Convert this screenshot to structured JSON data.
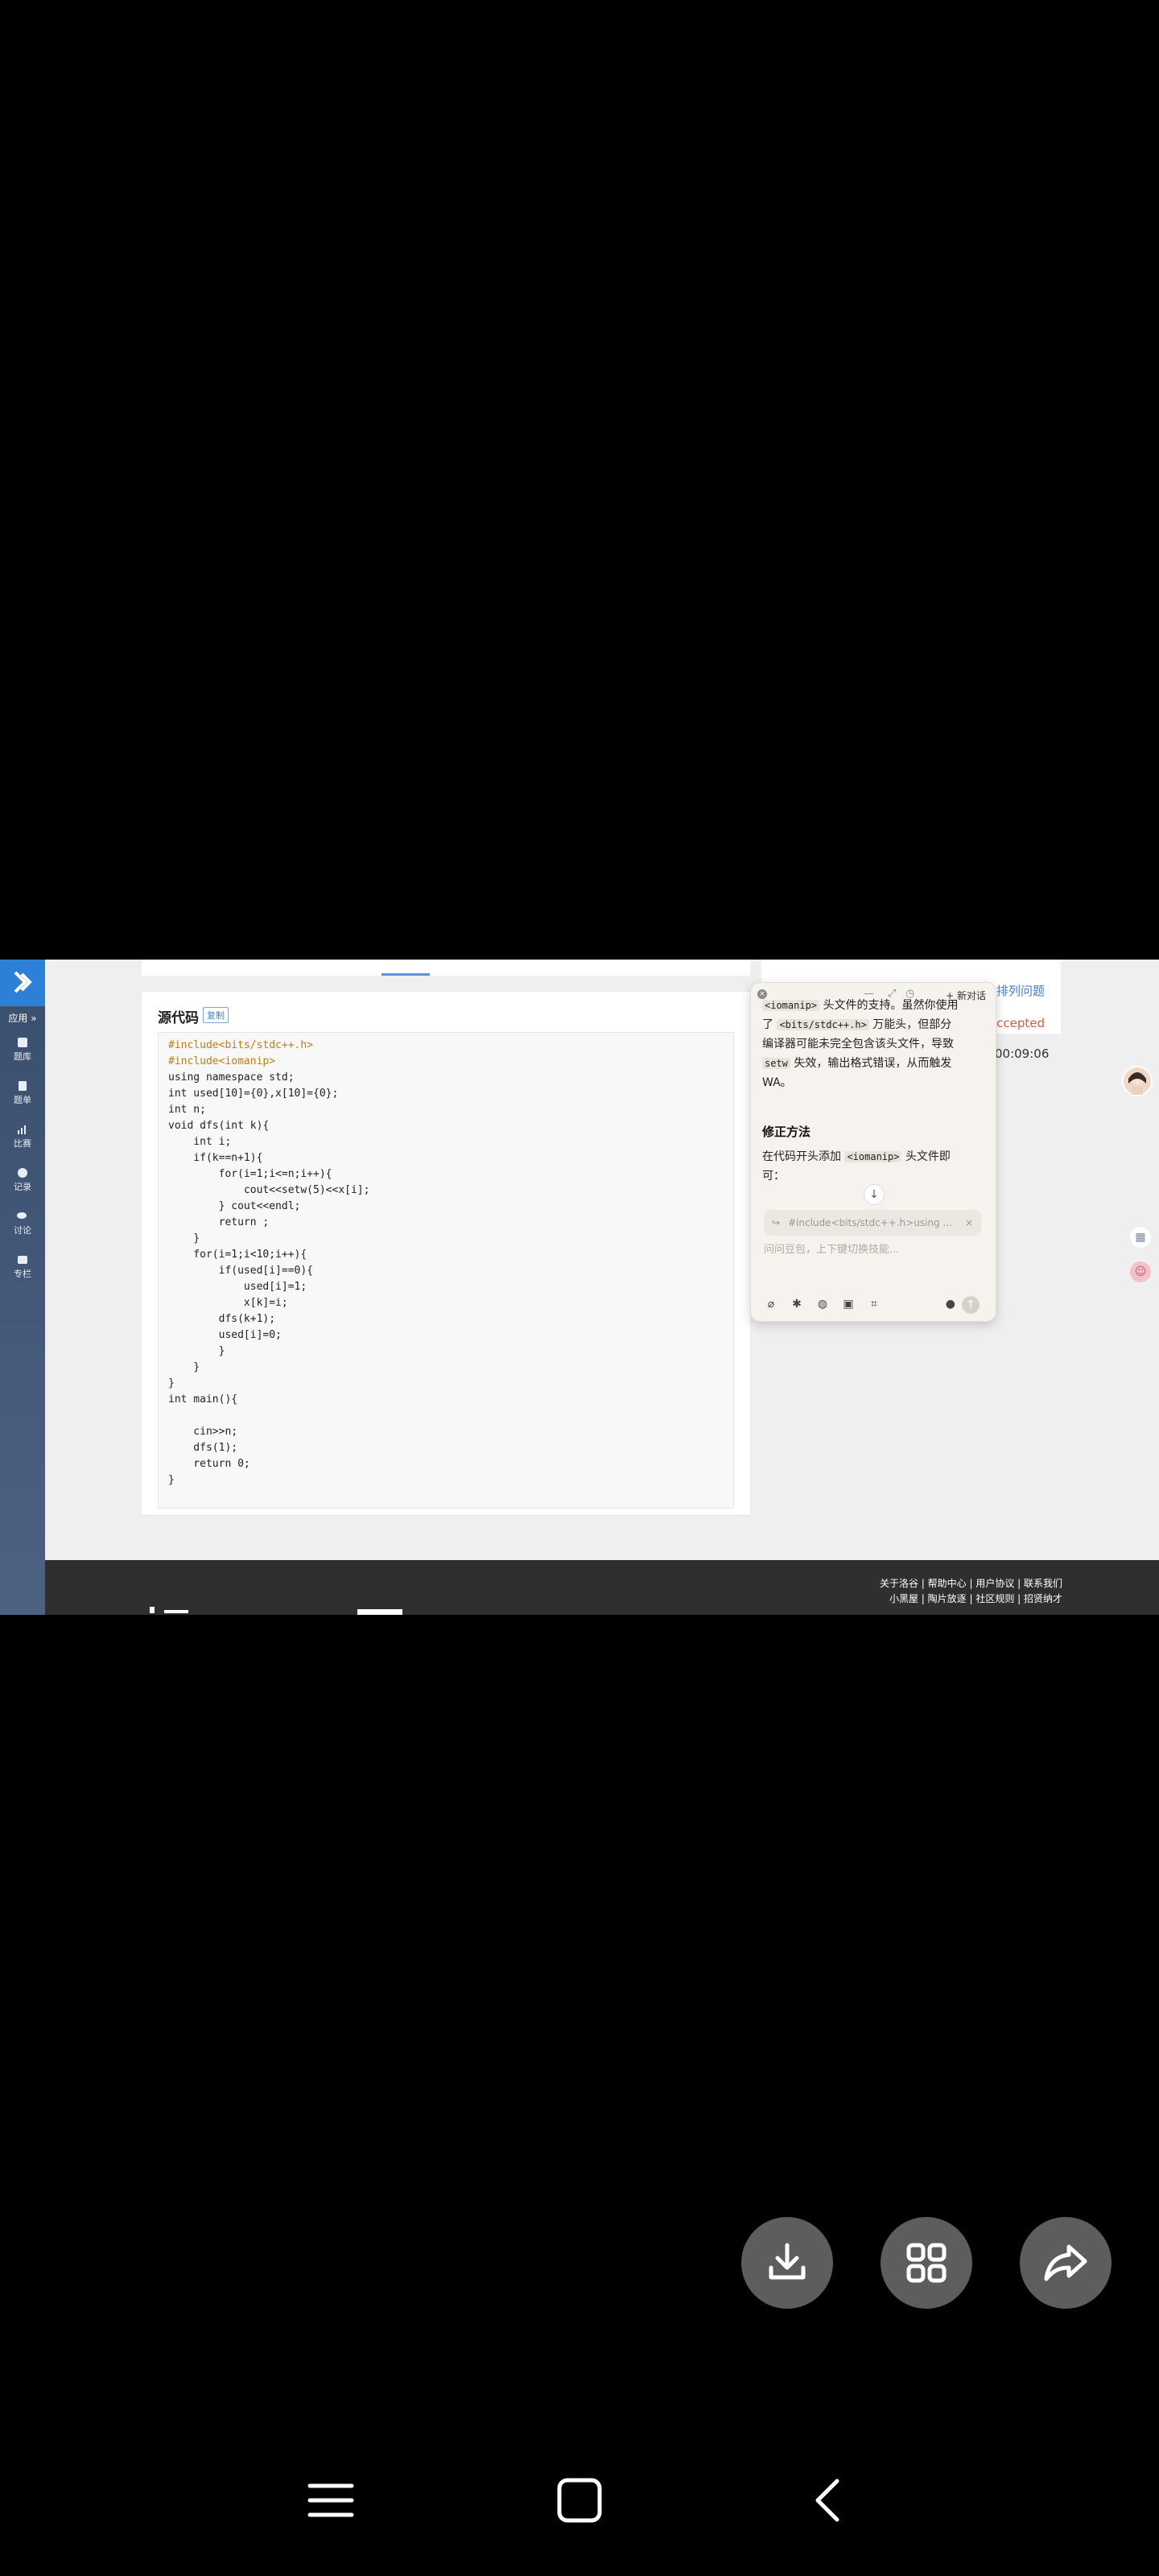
{
  "sidebar": {
    "apps_label": "应用",
    "items": [
      {
        "label": "题库",
        "icon": "book-icon"
      },
      {
        "label": "题单",
        "icon": "list-icon"
      },
      {
        "label": "比赛",
        "icon": "chart-icon"
      },
      {
        "label": "记录",
        "icon": "pie-icon"
      },
      {
        "label": "讨论",
        "icon": "chat-icon"
      },
      {
        "label": "专栏",
        "icon": "column-icon"
      }
    ]
  },
  "code_card": {
    "title": "源代码",
    "copy_label": "复制",
    "lines": [
      "#include<bits/stdc++.h>",
      "#include<iomanip>",
      "using namespace std;",
      "int used[10]={0},x[10]={0};",
      "int n;",
      "void dfs(int k){",
      "    int i;",
      "    if(k==n+1){",
      "        for(i=1;i<=n;i++){",
      "            cout<<setw(5)<<x[i];",
      "        } cout<<endl;",
      "        return ;",
      "    }",
      "    for(i=1;i<10;i++){",
      "        if(used[i]==0){",
      "            used[i]=1;",
      "            x[k]=i;",
      "        dfs(k+1);",
      "        used[i]=0;",
      "        }",
      "    }",
      "}",
      "int main(){",
      "",
      "    cin>>n;",
      "    dfs(1);",
      "    return 0;",
      "}"
    ]
  },
  "right_panel": {
    "link": "排列问题",
    "status": "accepted",
    "time": "00:09:06"
  },
  "ai_panel": {
    "new_chat_label": "新对话",
    "body_line1_pre": "头文件的支持。虽然你使用",
    "body_code_iomanip": "<iomanip>",
    "body_line2_pre": "了",
    "body_code_bits": "<bits/stdc++.h>",
    "body_line2_post": "万能头，但部分",
    "body_line3": "编译器可能未完全包含该头文件，导致",
    "body_code_setw": "setw",
    "body_line4_post": "失效，输出格式错误，从而触发",
    "body_line5": "WA。",
    "fix_title": "修正方法",
    "fix_text_pre": "在代码开头添加",
    "fix_code": "<iomanip>",
    "fix_text_post": "头文件即",
    "fix_text_end": "可：",
    "quote_text": "#include<bits/stdc++.h>using ...",
    "input_placeholder": "问问豆包，上下键切换技能..."
  },
  "footer": {
    "links_line1": "关于洛谷 | 帮助中心 | 用户协议 | 联系我们",
    "links_line2": "小黑屋 | 陶片放逐 | 社区规则 | 招贤纳才"
  },
  "bottom_actions": [
    {
      "icon": "download-icon"
    },
    {
      "icon": "apps-grid-icon"
    },
    {
      "icon": "share-icon"
    }
  ],
  "system_nav": [
    {
      "icon": "menu-icon"
    },
    {
      "icon": "home-icon"
    },
    {
      "icon": "back-icon"
    }
  ]
}
